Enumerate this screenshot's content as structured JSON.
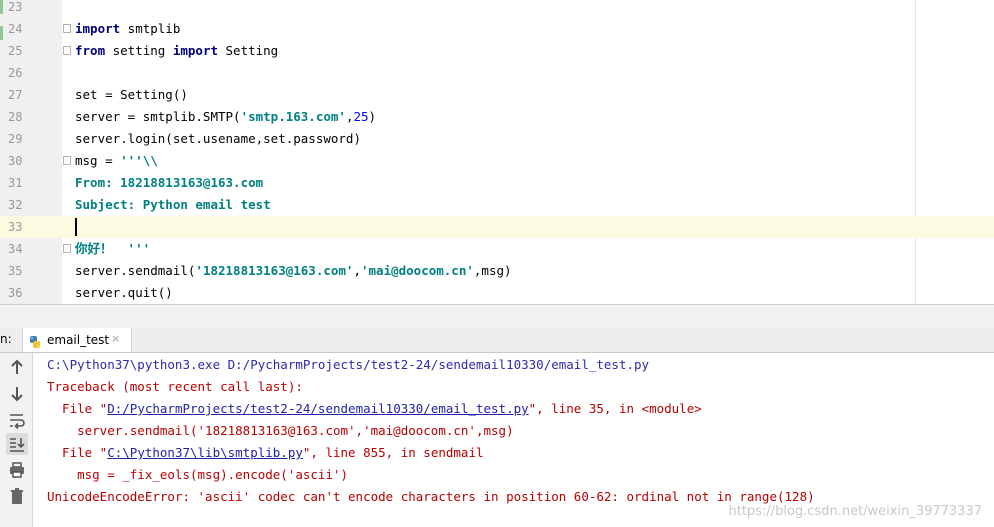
{
  "editor": {
    "lines": [
      {
        "n": "23",
        "tokens": []
      },
      {
        "n": "24",
        "fold": true,
        "tokens": [
          {
            "t": "import",
            "c": "kw"
          },
          {
            "t": " smtplib",
            "c": ""
          }
        ]
      },
      {
        "n": "25",
        "fold": true,
        "tokens": [
          {
            "t": "from",
            "c": "kw"
          },
          {
            "t": " setting ",
            "c": ""
          },
          {
            "t": "import",
            "c": "kw"
          },
          {
            "t": " Setting",
            "c": ""
          }
        ]
      },
      {
        "n": "26",
        "tokens": []
      },
      {
        "n": "27",
        "tokens": [
          {
            "t": "set = Setting()",
            "c": ""
          }
        ]
      },
      {
        "n": "28",
        "tokens": [
          {
            "t": "server = smtplib.SMTP(",
            "c": ""
          },
          {
            "t": "'smtp.163.com'",
            "c": "str"
          },
          {
            "t": ",",
            "c": ""
          },
          {
            "t": "25",
            "c": "num"
          },
          {
            "t": ")",
            "c": ""
          }
        ]
      },
      {
        "n": "29",
        "tokens": [
          {
            "t": "server.login(set.usename,set.password)",
            "c": ""
          }
        ]
      },
      {
        "n": "30",
        "fold": true,
        "tokens": [
          {
            "t": "msg = ",
            "c": ""
          },
          {
            "t": "'''\\\\",
            "c": "str"
          }
        ]
      },
      {
        "n": "31",
        "tokens": [
          {
            "t": "From: 18218813163@163.com",
            "c": "str"
          }
        ]
      },
      {
        "n": "32",
        "tokens": [
          {
            "t": "Subject: Python email test",
            "c": "str"
          }
        ]
      },
      {
        "n": "33",
        "current": true,
        "tokens": []
      },
      {
        "n": "34",
        "fold": true,
        "tokens": [
          {
            "t": "你好！  '''",
            "c": "str"
          }
        ]
      },
      {
        "n": "35",
        "tokens": [
          {
            "t": "server.sendmail(",
            "c": ""
          },
          {
            "t": "'18218813163@163.com'",
            "c": "str"
          },
          {
            "t": ",",
            "c": ""
          },
          {
            "t": "'mai@doocom.cn'",
            "c": "str"
          },
          {
            "t": ",msg)",
            "c": ""
          }
        ]
      },
      {
        "n": "36",
        "tokens": [
          {
            "t": "server.quit()",
            "c": ""
          }
        ]
      }
    ]
  },
  "run_panel": {
    "label": "n:",
    "tab_name": "email_test",
    "tab_close": "×"
  },
  "console": {
    "lines": [
      {
        "cls": "cmd",
        "parts": [
          {
            "t": "C:\\Python37\\python3.exe D:/PycharmProjects/test2-24/sendemail10330/email_test.py"
          }
        ]
      },
      {
        "cls": "",
        "parts": [
          {
            "t": "Traceback (most recent call last):"
          }
        ]
      },
      {
        "cls": "",
        "parts": [
          {
            "t": "  File \""
          },
          {
            "t": "D:/PycharmProjects/test2-24/sendemail10330/email_test.py",
            "link": true
          },
          {
            "t": "\", line 35, in <module>"
          }
        ]
      },
      {
        "cls": "",
        "parts": [
          {
            "t": "    server.sendmail('18218813163@163.com','mai@doocom.cn',msg)"
          }
        ]
      },
      {
        "cls": "",
        "parts": [
          {
            "t": "  File \""
          },
          {
            "t": "C:\\Python37\\lib\\smtplib.py",
            "link": true
          },
          {
            "t": "\", line 855, in sendmail"
          }
        ]
      },
      {
        "cls": "",
        "parts": [
          {
            "t": "    msg = _fix_eols(msg).encode('ascii')"
          }
        ]
      },
      {
        "cls": "",
        "parts": [
          {
            "t": "UnicodeEncodeError: 'ascii' codec can't encode characters in position 60-62: ordinal not in range(128)"
          }
        ]
      }
    ]
  },
  "toolbar_icons": [
    "arrow-up-icon",
    "arrow-down-icon",
    "soft-wrap-icon",
    "scroll-to-end-icon",
    "print-icon",
    "trash-icon"
  ],
  "watermark": "https://blog.csdn.net/weixin_39773337",
  "colors": {
    "keyword": "#000080",
    "string": "#008080",
    "number": "#0000ff",
    "error": "#b80000",
    "caret_line": "#fcfae1"
  }
}
